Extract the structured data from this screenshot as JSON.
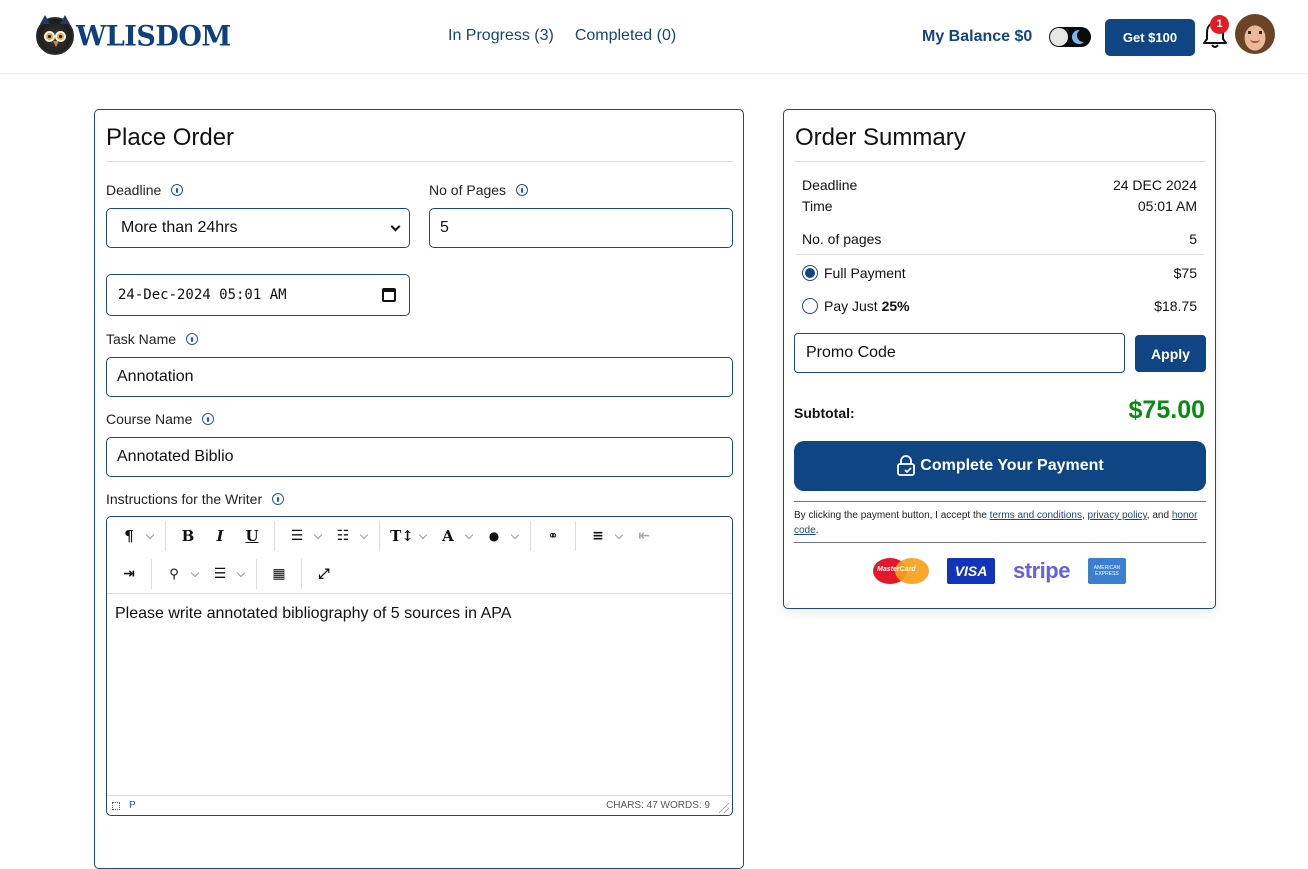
{
  "brand": {
    "name": "WLISDOM"
  },
  "nav": {
    "in_progress": "In Progress (3)",
    "completed": "Completed (0)"
  },
  "account": {
    "balance": "My Balance $0",
    "get_button": "Get $100",
    "notification_count": "1",
    "theme": "dark-mode-toggle"
  },
  "place_order": {
    "title": "Place Order",
    "deadline": {
      "label": "Deadline",
      "value": "More than 24hrs"
    },
    "pages": {
      "label": "No of Pages",
      "value": "5"
    },
    "datetime": {
      "value": "24-Dec-2024 05:01 AM"
    },
    "task_name": {
      "label": "Task Name",
      "value": "Annotation"
    },
    "course_name": {
      "label": "Course Name",
      "value": "Annotated Biblio"
    },
    "instructions": {
      "label": "Instructions for the Writer",
      "value": "Please write annotated bibliography of 5 sources in APA",
      "path": "P",
      "stats": "CHARS: 47   WORDS: 9",
      "toolbar_row1": [
        "paragraph",
        "bold",
        "italic",
        "underline",
        "bullet-list",
        "numbered-list",
        "font-size",
        "font",
        "color",
        "link",
        "align",
        "outdent"
      ],
      "toolbar_row2": [
        "indent",
        "find",
        "line-height",
        "table",
        "fullscreen"
      ]
    }
  },
  "summary": {
    "title": "Order Summary",
    "rows": [
      {
        "label": "Deadline",
        "value": "24 DEC 2024"
      },
      {
        "label": "Time",
        "value": "05:01 AM"
      },
      {
        "label": "No. of pages",
        "value": "5"
      }
    ],
    "payment_options": [
      {
        "label": "Full Payment",
        "value": "$75",
        "selected": true
      },
      {
        "label": "Pay Just",
        "bold": "25%",
        "value": "$18.75",
        "selected": false
      }
    ],
    "promo_placeholder": "Promo Code",
    "apply_label": "Apply",
    "subtotal_label": "Subtotal:",
    "subtotal_value": "$75.00",
    "pay_button": "Complete Your Payment",
    "terms": {
      "prefix": "By clicking the payment button, I accept the ",
      "terms_link": "terms and conditions",
      "sep1": ", ",
      "privacy_link": "privacy policy",
      "sep2": ", and ",
      "honor_link": "honor code",
      "suffix": "."
    },
    "payment_brands": [
      "MasterCard",
      "VISA",
      "stripe",
      "AMERICAN EXPRESS"
    ]
  },
  "colors": {
    "primary": "#0e4582",
    "success": "#0b8a12",
    "badge": "#e31b23"
  }
}
